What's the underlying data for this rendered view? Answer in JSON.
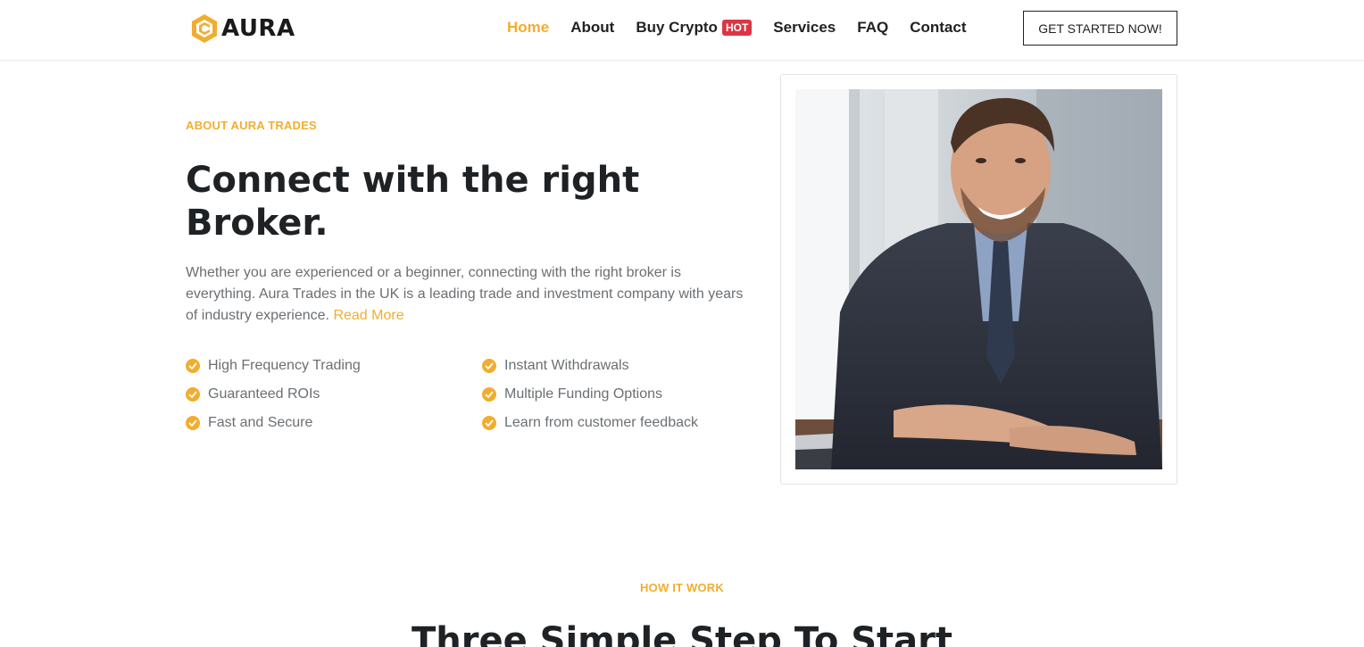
{
  "brand": {
    "name": "AURA",
    "accent": "#f2ad2f",
    "badge_color": "#dc3545"
  },
  "nav": {
    "items": [
      {
        "label": "Home",
        "active": true
      },
      {
        "label": "About"
      },
      {
        "label": "Buy Crypto",
        "badge": "HOT"
      },
      {
        "label": "Services"
      },
      {
        "label": "FAQ"
      },
      {
        "label": "Contact"
      }
    ],
    "cta": "GET STARTED NOW!"
  },
  "about": {
    "eyebrow": "ABOUT AURA TRADES",
    "heading_line1": "Connect with the right",
    "heading_line2": "Broker.",
    "paragraph": "Whether you are experienced or a beginner, connecting with the right broker is everything. Aura Trades in the UK is a leading trade and investment company with years of industry experience.",
    "read_more": "Read More",
    "features": [
      "High Frequency Trading",
      "Instant Withdrawals",
      "Guaranteed ROIs",
      "Multiple Funding Options",
      "Fast and Secure",
      "Learn from customer feedback"
    ],
    "check_icon": "check-circle-icon"
  },
  "how": {
    "eyebrow": "HOW IT WORK",
    "heading": "Three Simple Step To Start"
  }
}
